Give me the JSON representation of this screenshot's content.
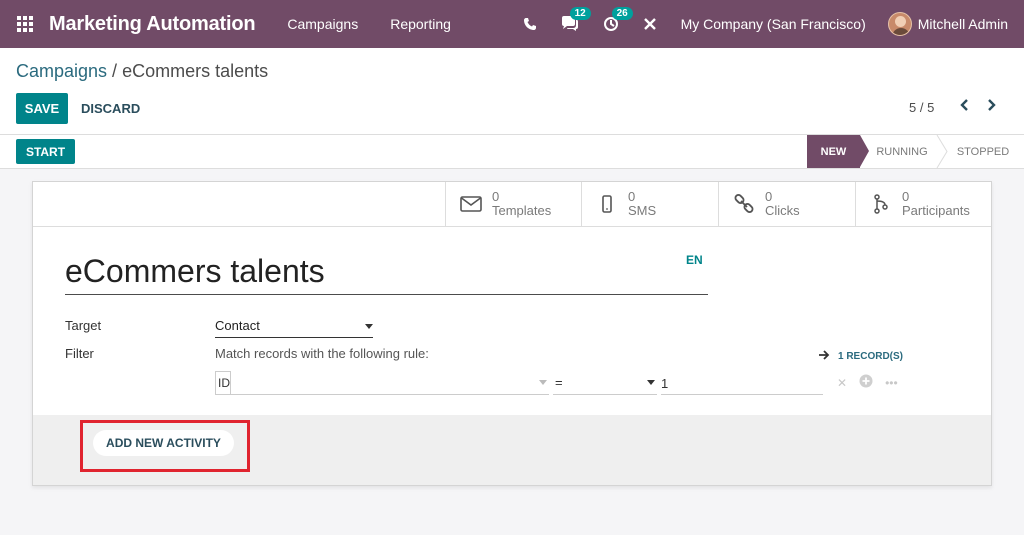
{
  "navbar": {
    "app_title": "Marketing Automation",
    "menus": [
      "Campaigns",
      "Reporting"
    ],
    "messages_count": "12",
    "activities_count": "26",
    "company": "My Company (San Francisco)",
    "user": "Mitchell Admin",
    "bg_color": "#714b67"
  },
  "breadcrumb": {
    "parent": "Campaigns",
    "separator": " / ",
    "current": "eCommers talents"
  },
  "buttons": {
    "save": "SAVE",
    "discard": "DISCARD",
    "start": "START",
    "add_activity": "ADD NEW ACTIVITY"
  },
  "pager": {
    "value": "5 / 5"
  },
  "status": {
    "stages": [
      "NEW",
      "RUNNING",
      "STOPPED"
    ],
    "active": "NEW"
  },
  "smart_buttons": [
    {
      "count": "0",
      "label": "Templates",
      "icon": "envelope-icon"
    },
    {
      "count": "0",
      "label": "SMS",
      "icon": "mobile-icon"
    },
    {
      "count": "0",
      "label": "Clicks",
      "icon": "link-icon"
    },
    {
      "count": "0",
      "label": "Participants",
      "icon": "participants-icon"
    }
  ],
  "form": {
    "title": "eCommers talents",
    "lang": "EN",
    "target_label": "Target",
    "target_value": "Contact",
    "filter_label": "Filter",
    "filter_desc": "Match records with the following rule:",
    "records_link": "1 RECORD(S)",
    "rule": {
      "field": "ID",
      "operator": "=",
      "value": "1"
    }
  },
  "colors": {
    "primary": "#00848a",
    "highlight": "#e0242f"
  }
}
